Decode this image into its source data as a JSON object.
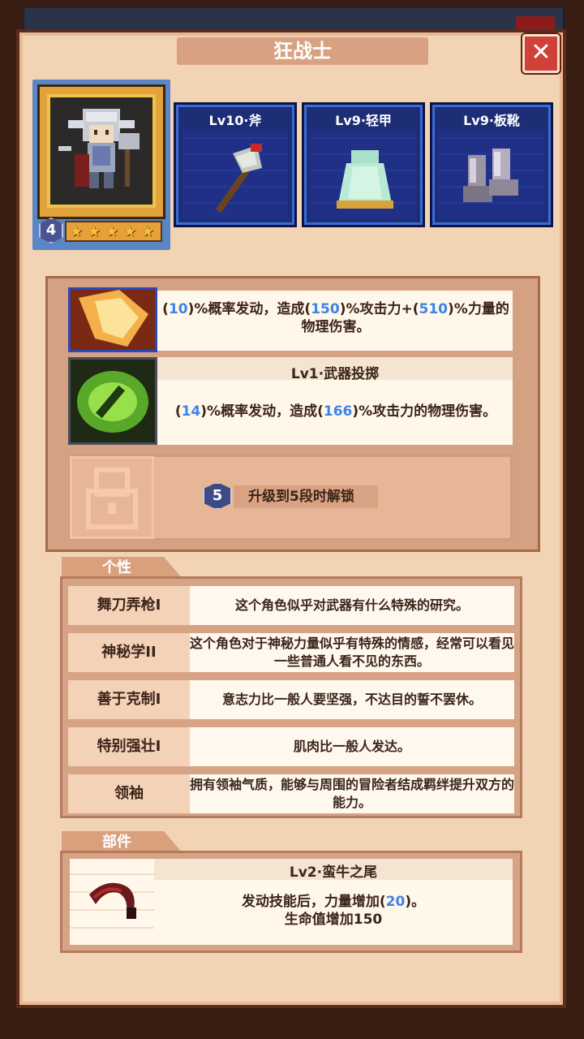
{
  "title": "狂战士",
  "close_label": "✕",
  "hero": {
    "level": "4",
    "stars": 5
  },
  "equipment": [
    {
      "label": "Lv10·斧",
      "icon": "axe-icon"
    },
    {
      "label": "Lv9·轻甲",
      "icon": "light-armor-icon"
    },
    {
      "label": "Lv9·板靴",
      "icon": "plate-boots-icon"
    }
  ],
  "skills": [
    {
      "name": "",
      "desc_parts": [
        "(",
        "10",
        ")%概率发动，造成(",
        "150",
        ")%攻击力+(",
        "510",
        ")%力量的"
      ],
      "desc_line2": "物理伤害。"
    },
    {
      "name": "Lv1·武器投掷",
      "desc_parts": [
        "(",
        "14",
        ")%概率发动，造成(",
        "166",
        ")%攻击力的物理伤害。"
      ]
    }
  ],
  "locked_skill": {
    "badge": "5",
    "text": "升级到5段时解锁"
  },
  "traits_header": "个性",
  "traits": [
    {
      "name": "舞刀弄枪I",
      "desc": "这个角色似乎对武器有什么特殊的研究。"
    },
    {
      "name": "神秘学II",
      "desc": "这个角色对于神秘力量似乎有特殊的情感，经常可以看见一些普通人看不见的东西。"
    },
    {
      "name": "善于克制I",
      "desc": "意志力比一般人要坚强，不达目的誓不罢休。"
    },
    {
      "name": "特别强壮I",
      "desc": "肌肉比一般人发达。"
    },
    {
      "name": "领袖",
      "desc": "拥有领袖气质，能够与周围的冒险者结成羁绊提升双方的能力。"
    }
  ],
  "parts_header": "部件",
  "part": {
    "name": "Lv2·蛮牛之尾",
    "desc_parts": [
      "发动技能后，力量增加(",
      "20",
      ")。"
    ],
    "desc_line2": "生命值增加150",
    "icon": "bull-tail-icon"
  },
  "colors": {
    "highlight": "#3c84e8",
    "panel": "#f2d4b4",
    "equip_bg": "#1d2d76",
    "close_red": "#d2403a"
  }
}
